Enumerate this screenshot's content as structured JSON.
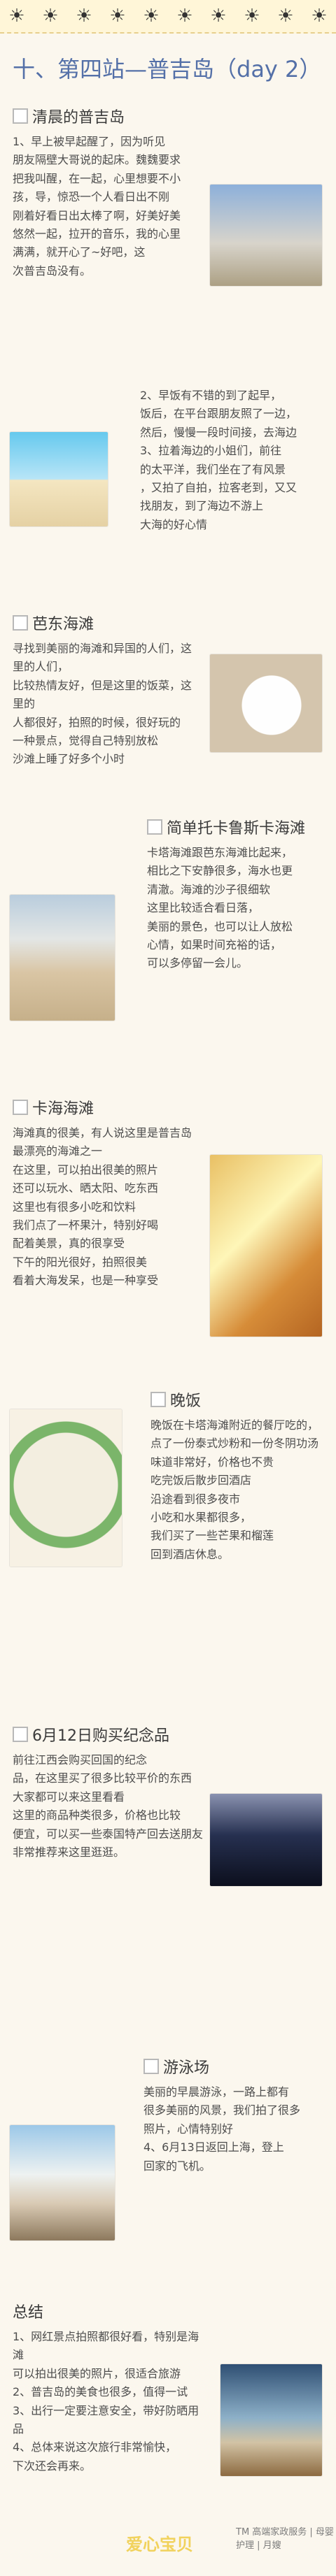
{
  "decor": {
    "emojis": [
      "☀",
      "☀",
      "☀",
      "☀",
      "☀",
      "☀",
      "☀",
      "☀",
      "☀",
      "☀"
    ]
  },
  "title": "十、第四站—普吉岛（day 2）",
  "sections": [
    {
      "heading": "清晨的普吉岛",
      "text": "1、早上被早起醒了，因为听见\n朋友隔壁大哥说的起床。魏魏要求\n把我叫醒，在一起，心里想要不小\n孩，导，惊恐一个人看日出不刚\n刚着好看日出太棒了啊，好美好美\n悠然一起，拉开的音乐，我的心里\n满满，就开心了~好吧，这\n次普吉岛没有。"
    },
    {
      "heading": "",
      "text": "2、早饭有不错的到了起早，\n饭后，在平台跟朋友照了一边，\n然后，慢慢一段时间接，去海边\n3、拉着海边的小姐们，前往\n的太平洋，我们坐在了有风景\n，又拍了自拍，拉客老到，又又\n找朋友，到了海边不游上\n大海的好心情"
    },
    {
      "heading": "芭东海滩",
      "text": "寻找到美丽的海滩和异国的人们，这里的人们，\n比较热情友好，但是这里的饭菜，这里的\n人都很好，拍照的时候，很好玩的\n一种景点，觉得自己特别放松\n沙滩上睡了好多个小时"
    },
    {
      "heading": "简单托卡鲁斯卡海滩",
      "text": "卡塔海滩跟芭东海滩比起来，\n相比之下安静很多，海水也更\n清澈。海滩的沙子很细软\n这里比较适合看日落，\n美丽的景色，也可以让人放松\n心情，如果时间充裕的话，\n可以多停留一会儿。"
    },
    {
      "heading": "卡海海滩",
      "text": "海滩真的很美，有人说这里是普吉岛最漂亮的海滩之一\n在这里，可以拍出很美的照片\n还可以玩水、晒太阳、吃东西\n这里也有很多小吃和饮料\n我们点了一杯果汁，特别好喝\n配着美景，真的很享受\n下午的阳光很好，拍照很美\n看着大海发呆，也是一种享受"
    },
    {
      "heading": "晚饭",
      "text": "晚饭在卡塔海滩附近的餐厅吃的，\n点了一份泰式炒粉和一份冬阴功汤\n味道非常好，价格也不贵\n吃完饭后散步回酒店\n沿途看到很多夜市\n小吃和水果都很多，\n我们买了一些芒果和榴莲\n回到酒店休息。"
    },
    {
      "heading": "6月12日购买纪念品",
      "text": "前往江西会购买回国的纪念\n品，在这里买了很多比较平价的东西\n大家都可以来这里看看\n这里的商品种类很多，价格也比较\n便宜，可以买一些泰国特产回去送朋友\n非常推荐来这里逛逛。"
    },
    {
      "heading": "游泳场",
      "text": "美丽的早晨游泳，一路上都有\n很多美丽的风景，我们拍了很多\n照片，心情特别好\n4、6月13日返回上海，登上\n回家的飞机。"
    },
    {
      "heading": "总结",
      "text": "1、网红景点拍照都很好看，特别是海滩\n可以拍出很美的照片，很适合旅游\n2、普吉岛的美食也很多，值得一试\n3、出行一定要注意安全，带好防晒用品\n4、总体来说这次旅行非常愉快，\n下次还会再来。"
    }
  ],
  "captions": [
    "",
    "",
    "",
    "",
    "",
    "",
    "",
    "",
    "",
    "",
    ""
  ],
  "logos": {
    "left": "爱心宝贝",
    "right": "TM 高端家政服务 | 母婴护理 | 月嫂"
  }
}
